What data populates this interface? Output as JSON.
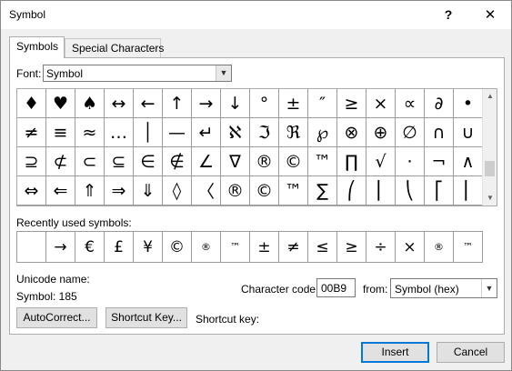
{
  "window": {
    "title": "Symbol",
    "help_label": "?",
    "close_label": "✕"
  },
  "tabs": [
    {
      "label": "Symbols",
      "active": true
    },
    {
      "label": "Special Characters",
      "active": false
    }
  ],
  "font": {
    "label": "Font:",
    "value": "Symbol"
  },
  "symbol_grid": {
    "selected_index": 16,
    "rows": [
      [
        "♦",
        "♥",
        "♠",
        "↔",
        "←",
        "↑",
        "→",
        "↓",
        "°",
        "±",
        "″",
        "≥",
        "×",
        "∝",
        "∂",
        "•",
        "÷"
      ],
      [
        "≠",
        "≡",
        "≈",
        "…",
        "│",
        "—",
        "↵",
        "ℵ",
        "ℑ",
        "ℜ",
        "℘",
        "⊗",
        "⊕",
        "∅",
        "∩",
        "∪",
        "⊃"
      ],
      [
        "⊇",
        "⊄",
        "⊂",
        "⊆",
        "∈",
        "∉",
        "∠",
        "∇",
        "®",
        "©",
        "™",
        "∏",
        "√",
        "·",
        "¬",
        "∧",
        "∨"
      ],
      [
        "⇔",
        "⇐",
        "⇑",
        "⇒",
        "⇓",
        "◊",
        "〈",
        "®",
        "©",
        "™",
        "∑",
        "⎛",
        "⎜",
        "⎝",
        "⎡",
        "⎢",
        "⎣"
      ]
    ]
  },
  "recent": {
    "label": "Recently used symbols:",
    "symbols": [
      "",
      "→",
      "€",
      "£",
      "¥",
      "©",
      "®",
      "™",
      "±",
      "≠",
      "≤",
      "≥",
      "÷",
      "×",
      "®",
      "™",
      "∞"
    ]
  },
  "unicode": {
    "name_label": "Unicode name:",
    "name_value": "Symbol: 185"
  },
  "character_code": {
    "label": "Character code:",
    "value": "00B9"
  },
  "from": {
    "label": "from:",
    "value": "Symbol (hex)"
  },
  "buttons": {
    "autocorrect": "AutoCorrect...",
    "shortcut_key": "Shortcut Key...",
    "insert": "Insert",
    "cancel": "Cancel"
  },
  "shortcut_key_label": "Shortcut key:"
}
